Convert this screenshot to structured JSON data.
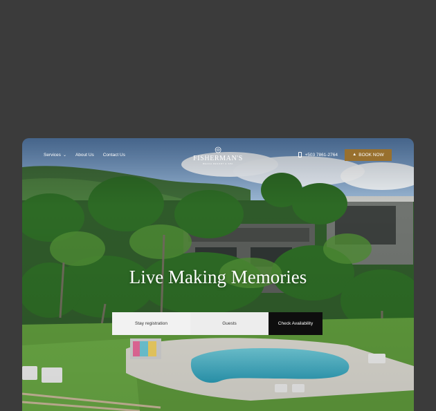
{
  "nav": {
    "services": "Services",
    "about": "About Us",
    "contact": "Contact Us",
    "phone": "+503 7861-2764",
    "book_now": "BOOK NOW",
    "chevron": "⌄"
  },
  "logo": {
    "title": "FISHERMAN'S",
    "subtitle": "BEACH RESORT & SPA"
  },
  "hero": {
    "headline": "Live Making Memories"
  },
  "booking": {
    "stay": "Stay registration",
    "guests": "Guests",
    "check": "Check Availability"
  },
  "colors": {
    "backdrop": "#3b3b3b",
    "accent": "#98702e",
    "button_dark": "#0e0e0e"
  }
}
